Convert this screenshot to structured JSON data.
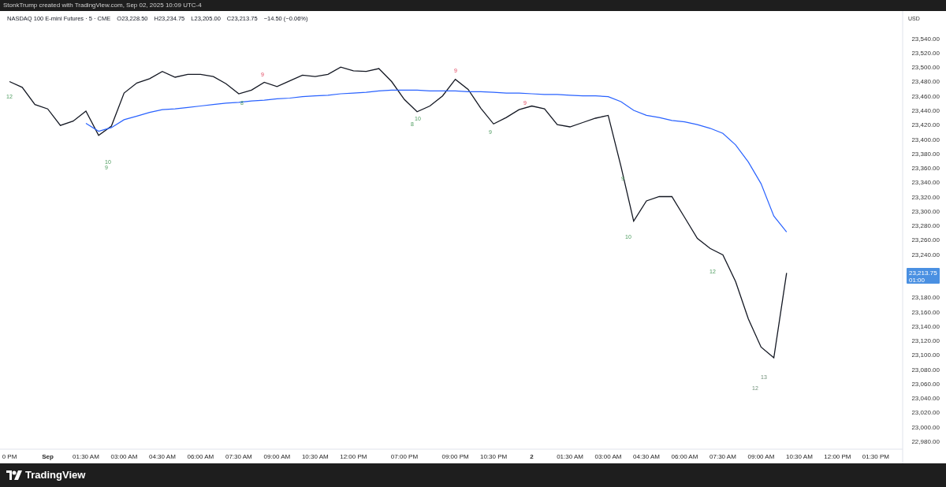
{
  "credit": "StonkTrump created with TradingView.com, Sep 02, 2025 10:09 UTC-4",
  "legend": {
    "title": "NASDAQ 100 E-mini Futures · 5 · CME",
    "values": [
      "O23,228.50",
      "H23,234.75",
      "L23,205.00",
      "C23,213.75",
      "−14.50 (−0.06%)"
    ]
  },
  "currency": "USD",
  "price_tag": {
    "price": "23,213.75",
    "countdown": "01:00"
  },
  "chart_data": {
    "type": "line",
    "ylim": [
      22969,
      23578
    ],
    "yticks": [
      {
        "value": 23540,
        "label": "23,540.00"
      },
      {
        "value": 23520,
        "label": "23,520.00"
      },
      {
        "value": 23500,
        "label": "23,500.00"
      },
      {
        "value": 23480,
        "label": "23,480.00"
      },
      {
        "value": 23460,
        "label": "23,460.00"
      },
      {
        "value": 23440,
        "label": "23,440.00"
      },
      {
        "value": 23420,
        "label": "23,420.00"
      },
      {
        "value": 23400,
        "label": "23,400.00"
      },
      {
        "value": 23380,
        "label": "23,380.00"
      },
      {
        "value": 23360,
        "label": "23,360.00"
      },
      {
        "value": 23340,
        "label": "23,340.00"
      },
      {
        "value": 23320,
        "label": "23,320.00"
      },
      {
        "value": 23300,
        "label": "23,300.00"
      },
      {
        "value": 23280,
        "label": "23,280.00"
      },
      {
        "value": 23260,
        "label": "23,260.00"
      },
      {
        "value": 23240,
        "label": "23,240.00"
      },
      {
        "value": 23180,
        "label": "23,180.00"
      },
      {
        "value": 23160,
        "label": "23,160.00"
      },
      {
        "value": 23140,
        "label": "23,140.00"
      },
      {
        "value": 23120,
        "label": "23,120.00"
      },
      {
        "value": 23100,
        "label": "23,100.00"
      },
      {
        "value": 23080,
        "label": "23,080.00"
      },
      {
        "value": 23060,
        "label": "23,060.00"
      },
      {
        "value": 23040,
        "label": "23,040.00"
      },
      {
        "value": 23020,
        "label": "23,020.00"
      },
      {
        "value": 23000,
        "label": "23,000.00"
      },
      {
        "value": 22980,
        "label": "22,980.00"
      }
    ],
    "categories": [
      "0 PM",
      null,
      null,
      "Sep",
      null,
      null,
      "01:30 AM",
      null,
      null,
      "03:00 AM",
      null,
      null,
      "04:30 AM",
      null,
      null,
      "06:00 AM",
      null,
      null,
      "07:30 AM",
      null,
      null,
      "09:00 AM",
      null,
      null,
      "10:30 AM",
      null,
      null,
      "12:00 PM",
      null,
      null,
      null,
      "07:00 PM",
      null,
      null,
      null,
      "09:00 PM",
      null,
      null,
      "10:30 PM",
      null,
      null,
      "2",
      null,
      null,
      "01:30 AM",
      null,
      null,
      "03:00 AM",
      null,
      null,
      "04:30 AM",
      null,
      null,
      "06:00 AM",
      null,
      null,
      "07:30 AM",
      null,
      null,
      "09:00 AM",
      null,
      null,
      "10:30 AM",
      null,
      null,
      "12:00 PM",
      null,
      null,
      "01:30 PM",
      null
    ],
    "series": [
      {
        "color": "#131722",
        "values": [
          23480,
          23472,
          23448,
          23442,
          23419,
          23425,
          23439,
          23405,
          23418,
          23464,
          23478,
          23484,
          23494,
          23486,
          23490,
          23490,
          23487,
          23477,
          23463,
          23468,
          23479,
          23473,
          23481,
          23489,
          23487,
          23490,
          23500,
          23495,
          23494,
          23498,
          23480,
          23455,
          23438,
          23446,
          23460,
          23483,
          23469,
          23443,
          23421,
          23430,
          23441,
          23446,
          23442,
          23420,
          23417,
          23423,
          23429,
          23433,
          23362,
          23286,
          23314,
          23320,
          23320,
          23291,
          23262,
          23248,
          23239,
          23202,
          23150,
          23111,
          23096,
          23214,
          null,
          null,
          null,
          null,
          null,
          null,
          null,
          null
        ]
      },
      {
        "color": "#2962ff",
        "values": [
          null,
          null,
          null,
          null,
          null,
          null,
          23422,
          23411,
          23416,
          23427,
          23432,
          23437,
          23441,
          23442,
          23444,
          23446,
          23448,
          23450,
          23451,
          23453,
          23454,
          23456,
          23457,
          23459,
          23460,
          23461,
          23463,
          23464,
          23465,
          23467,
          23468,
          23468,
          23468,
          23467,
          23467,
          23467,
          23466,
          23466,
          23465,
          23464,
          23464,
          23463,
          23462,
          23462,
          23461,
          23460,
          23460,
          23459,
          23452,
          23440,
          23433,
          23430,
          23426,
          23424,
          23420,
          23415,
          23408,
          23392,
          23368,
          23338,
          23293,
          23271,
          null,
          null,
          null,
          null,
          null,
          null,
          null,
          null
        ]
      }
    ],
    "annotations": [
      "12",
      "10",
      "9",
      "8",
      "9",
      "8",
      "10",
      "9",
      "9",
      "9",
      "9",
      "10",
      "12",
      "13",
      "12"
    ]
  },
  "footer": {
    "brand": "TradingView"
  }
}
